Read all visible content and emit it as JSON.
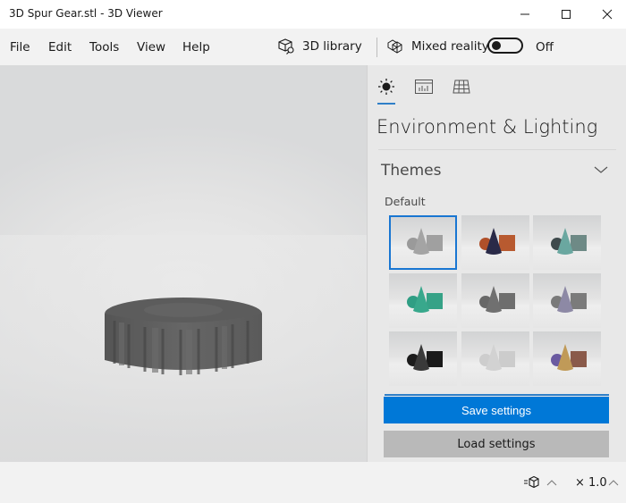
{
  "window": {
    "title": "3D Spur Gear.stl - 3D Viewer",
    "controls": [
      "minimize",
      "maximize",
      "close"
    ]
  },
  "menu": {
    "items": [
      "File",
      "Edit",
      "Tools",
      "View",
      "Help"
    ],
    "library_label": "3D library",
    "mixed_reality_label": "Mixed reality",
    "mixed_reality_state": "Off",
    "mixed_reality_on": false
  },
  "viewport": {
    "model": "3D Spur Gear",
    "model_color": "#5f5f5f"
  },
  "panel": {
    "tabs": [
      {
        "name": "environment-lighting",
        "icon": "sun-icon",
        "active": true
      },
      {
        "name": "stats-shading",
        "icon": "chart-icon",
        "active": false
      },
      {
        "name": "grid-views",
        "icon": "grid-icon",
        "active": false
      }
    ],
    "title": "Environment & Lighting",
    "themes_label": "Themes",
    "theme_group_label": "Default",
    "themes": [
      {
        "name": "default-gray",
        "selected": true,
        "sphere": "#9a9a9a",
        "cone": "#a4a4a4",
        "box": "#a0a0a0"
      },
      {
        "name": "copper-navy",
        "selected": false,
        "sphere": "#b0502a",
        "cone": "#2a2a48",
        "box": "#b85a30"
      },
      {
        "name": "teal-dark",
        "selected": false,
        "sphere": "#3e4a4c",
        "cone": "#6aa7a0",
        "box": "#6e8a86"
      },
      {
        "name": "emerald",
        "selected": false,
        "sphere": "#2f9e84",
        "cone": "#38a88c",
        "box": "#36a287"
      },
      {
        "name": "slate",
        "selected": false,
        "sphere": "#686868",
        "cone": "#707070",
        "box": "#6e6e6e"
      },
      {
        "name": "lavender",
        "selected": false,
        "sphere": "#7a7a7a",
        "cone": "#8d89a5",
        "box": "#7b7b7b"
      },
      {
        "name": "black",
        "selected": false,
        "sphere": "#1c1c1c",
        "cone": "#3a3a3a",
        "box": "#1a1a1a"
      },
      {
        "name": "white",
        "selected": false,
        "sphere": "#cdcdcd",
        "cone": "#d2d2d2",
        "box": "#cccccc"
      },
      {
        "name": "gold-purple",
        "selected": false,
        "sphere": "#6a5aa0",
        "cone": "#c09a58",
        "box": "#8a5a4a"
      }
    ],
    "save_label": "Save settings",
    "load_label": "Load settings"
  },
  "status": {
    "speed_label": "× 1.0"
  },
  "colors": {
    "accent": "#0078d7",
    "secondary_button": "#b9b9b9"
  }
}
